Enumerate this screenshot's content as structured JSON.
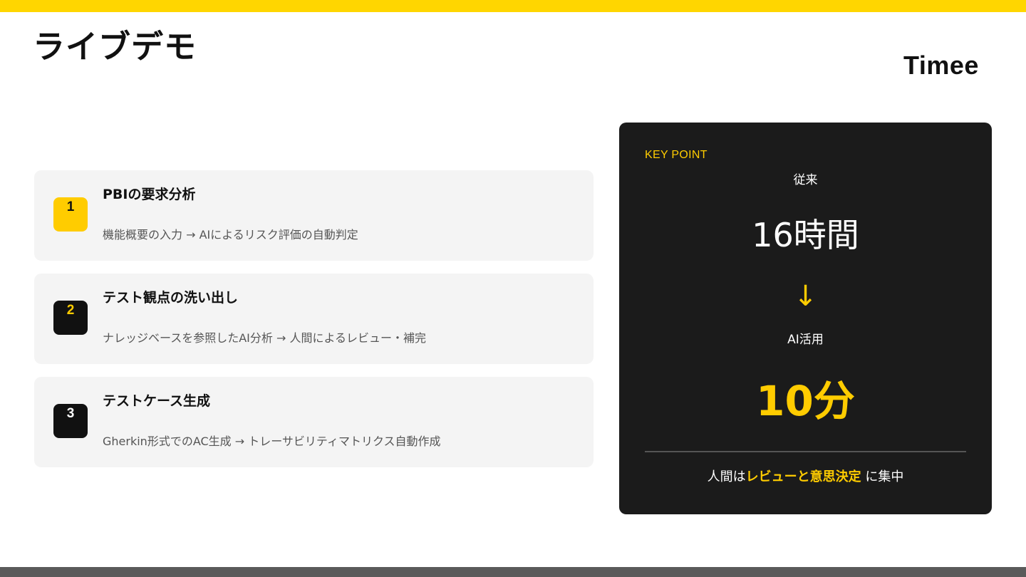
{
  "page": {
    "title": "ライブデモ",
    "logo": "Timee"
  },
  "colors": {
    "accent": "#FFD600",
    "panel": "#1b1b1b",
    "card": "#f4f4f4"
  },
  "steps": [
    {
      "number": "1",
      "title": "PBIの要求分析",
      "description": "機能概要の入力 → AIによるリスク評価の自動判定"
    },
    {
      "number": "2",
      "title": "テスト観点の洗い出し",
      "description": "ナレッジベースを参照したAI分析 → 人間によるレビュー・補完"
    },
    {
      "number": "3",
      "title": "テストケース生成",
      "description": "Gherkin形式でのAC生成 → トレーサビリティマトリクス自動作成"
    }
  ],
  "key_point": {
    "label": "KEY POINT",
    "before_label": "従来",
    "before_value": "16時間",
    "arrow": "↓",
    "after_label": "AI活用",
    "after_value": "10分",
    "footer_prefix": "人間は",
    "footer_highlight": "レビューと意思決定",
    "footer_suffix": " に集中"
  }
}
